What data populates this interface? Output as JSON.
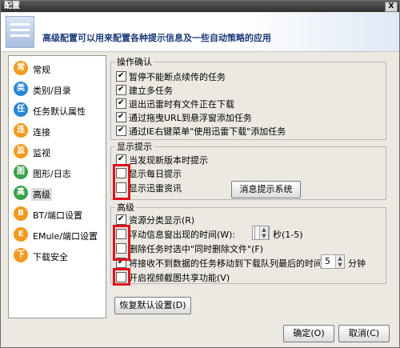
{
  "window": {
    "title": "配置",
    "close_label": "X"
  },
  "header": {
    "text": "高级配置可以用来配置各种提示信息及一些自动策略的应用"
  },
  "sidebar": {
    "items": [
      {
        "label": "常规",
        "color": "#f39a1e",
        "icon": "常"
      },
      {
        "label": "类别/目录",
        "color": "#2a86d6",
        "icon": "类"
      },
      {
        "label": "任务默认属性",
        "color": "#2a86d6",
        "icon": "任"
      },
      {
        "label": "连接",
        "color": "#f39a1e",
        "icon": "连"
      },
      {
        "label": "监视",
        "color": "#f39a1e",
        "icon": "监"
      },
      {
        "label": "图形/日志",
        "color": "#3aa24a",
        "icon": "图"
      },
      {
        "label": "高级",
        "color": "#3aa24a",
        "icon": "高"
      },
      {
        "label": "BT/端口设置",
        "color": "#f39a1e",
        "icon": "B"
      },
      {
        "label": "EMule/端口设置",
        "color": "#f39a1e",
        "icon": "E"
      },
      {
        "label": "下载安全",
        "color": "#f39a1e",
        "icon": "下"
      }
    ]
  },
  "groups": {
    "ops": {
      "title": "操作确认",
      "items": [
        {
          "label": "暂停不能断点续传的任务",
          "checked": true
        },
        {
          "label": "建立多任务",
          "checked": true
        },
        {
          "label": "退出迅雷时有文件正在下载",
          "checked": true
        },
        {
          "label": "通过拖曳URL到悬浮窗添加任务",
          "checked": true
        },
        {
          "label": "通过IE右键菜单\"使用迅雷下载\"添加任务",
          "checked": true
        }
      ]
    },
    "tips": {
      "title": "显示提示",
      "items": [
        {
          "label": "当发现新版本时提示",
          "checked": true
        },
        {
          "label": "显示每日提示",
          "checked": false
        },
        {
          "label": "显示迅雷资讯",
          "checked": false
        }
      ],
      "button": "消息提示系统"
    },
    "adv": {
      "title": "高级",
      "items": [
        {
          "label": "资源分类显示(R)",
          "checked": true
        },
        {
          "label": "浮动信息窗出现的时间(W):",
          "checked": false
        },
        {
          "label": "删除任务时选中\"同时删除文件\"(F)",
          "checked": false
        },
        {
          "label": "将接收不到数据的任务移动到下载队列最后的时间(T):",
          "checked": true
        },
        {
          "label": "开启视频截图共享功能(V)",
          "checked": false
        }
      ],
      "float_value": "5",
      "float_unit": "秒(1-5)",
      "move_value": "5",
      "move_unit": "分钟"
    }
  },
  "buttons": {
    "restore": "恢复默认设置(D)",
    "ok": "确定(O)",
    "cancel": "取消(C)"
  }
}
